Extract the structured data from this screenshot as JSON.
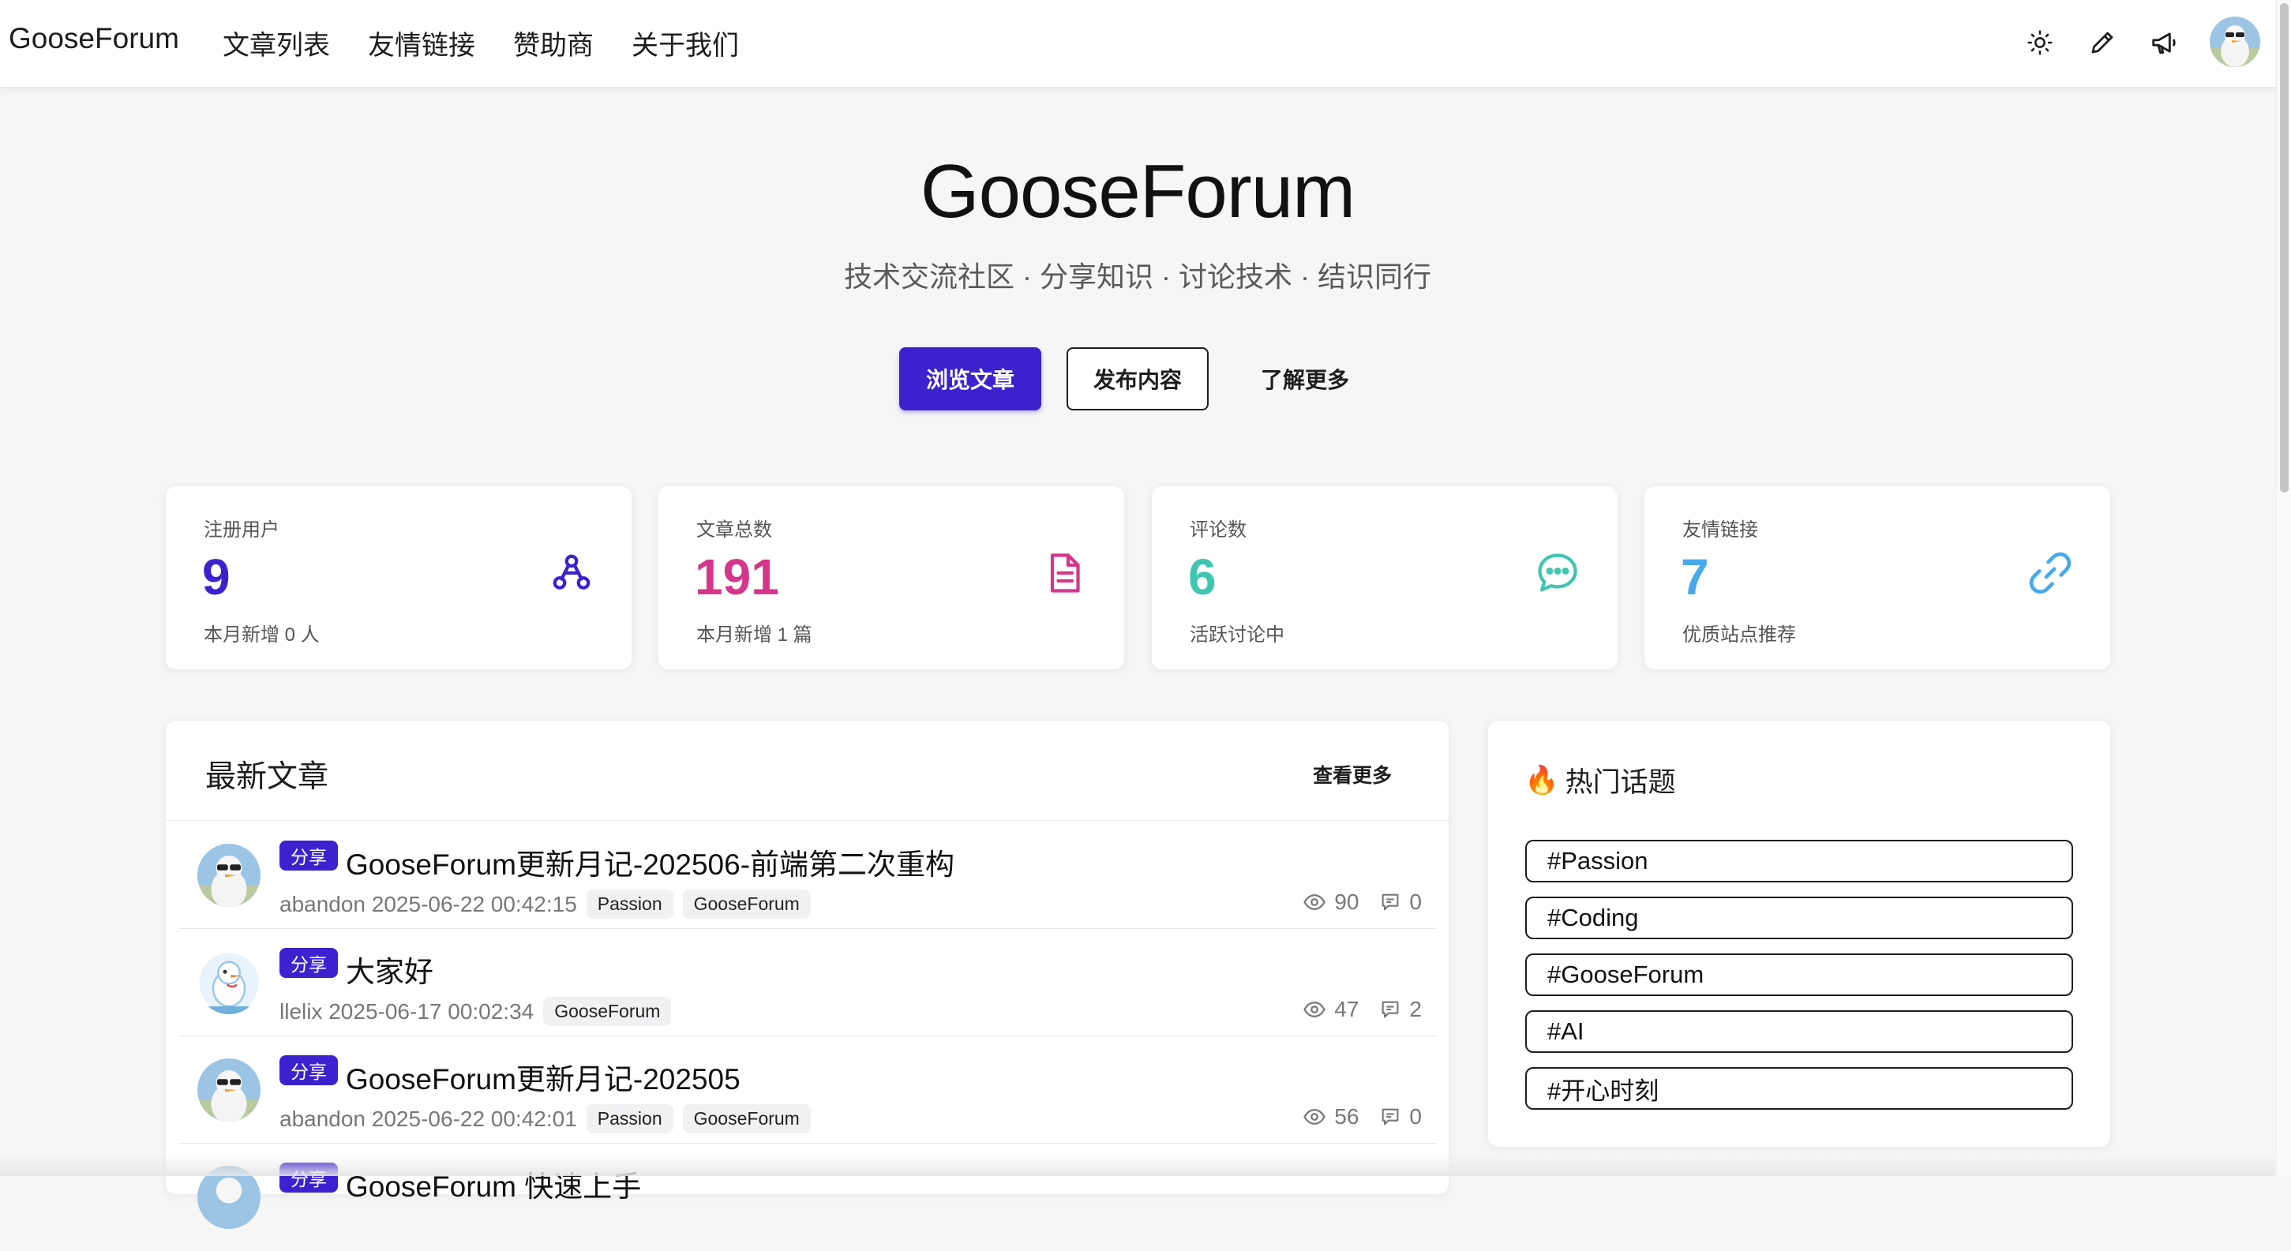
{
  "nav": {
    "brand": "GooseForum",
    "links": [
      "文章列表",
      "友情链接",
      "赞助商",
      "关于我们"
    ],
    "icons": [
      "sun-icon",
      "pencil-icon",
      "megaphone-icon"
    ]
  },
  "hero": {
    "title": "GooseForum",
    "subtitle": "技术交流社区 · 分享知识 · 讨论技术 · 结识同行",
    "buttons": {
      "browse": "浏览文章",
      "publish": "发布内容",
      "learn": "了解更多"
    }
  },
  "stats": [
    {
      "label": "注册用户",
      "value": "9",
      "desc": "本月新增 0 人",
      "color": "#3c22cf",
      "icon": "users-icon"
    },
    {
      "label": "文章总数",
      "value": "191",
      "desc": "本月新增 1 篇",
      "color": "#d6368a",
      "icon": "document-icon"
    },
    {
      "label": "评论数",
      "value": "6",
      "desc": "活跃讨论中",
      "color": "#3fc6b0",
      "icon": "chat-icon"
    },
    {
      "label": "友情链接",
      "value": "7",
      "desc": "优质站点推荐",
      "color": "#45a9ec",
      "icon": "link-icon"
    }
  ],
  "articles": {
    "heading": "最新文章",
    "more": "查看更多",
    "items": [
      {
        "tag": "分享",
        "title": "GooseForum更新月记-202506-前端第二次重构",
        "author_time": "abandon 2025-06-22 00:42:15",
        "labels": [
          "Passion",
          "GooseForum"
        ],
        "views": "90",
        "comments": "0",
        "avatar": "goose-sunglasses"
      },
      {
        "tag": "分享",
        "title": "大家好",
        "author_time": "llelix 2025-06-17 00:02:34",
        "labels": [
          "GooseForum"
        ],
        "views": "47",
        "comments": "2",
        "avatar": "goose-cartoon"
      },
      {
        "tag": "分享",
        "title": "GooseForum更新月记-202505",
        "author_time": "abandon 2025-06-22 00:42:01",
        "labels": [
          "Passion",
          "GooseForum"
        ],
        "views": "56",
        "comments": "0",
        "avatar": "goose-sunglasses"
      },
      {
        "tag": "分享",
        "title": "GooseForum 快速上手",
        "author_time": "",
        "labels": [],
        "views": "",
        "comments": "",
        "avatar": "goose-sunglasses"
      }
    ]
  },
  "topics": {
    "emoji": "🔥",
    "heading": "热门话题",
    "items": [
      "#Passion",
      "#Coding",
      "#GooseForum",
      "#AI",
      "#开心时刻"
    ]
  }
}
